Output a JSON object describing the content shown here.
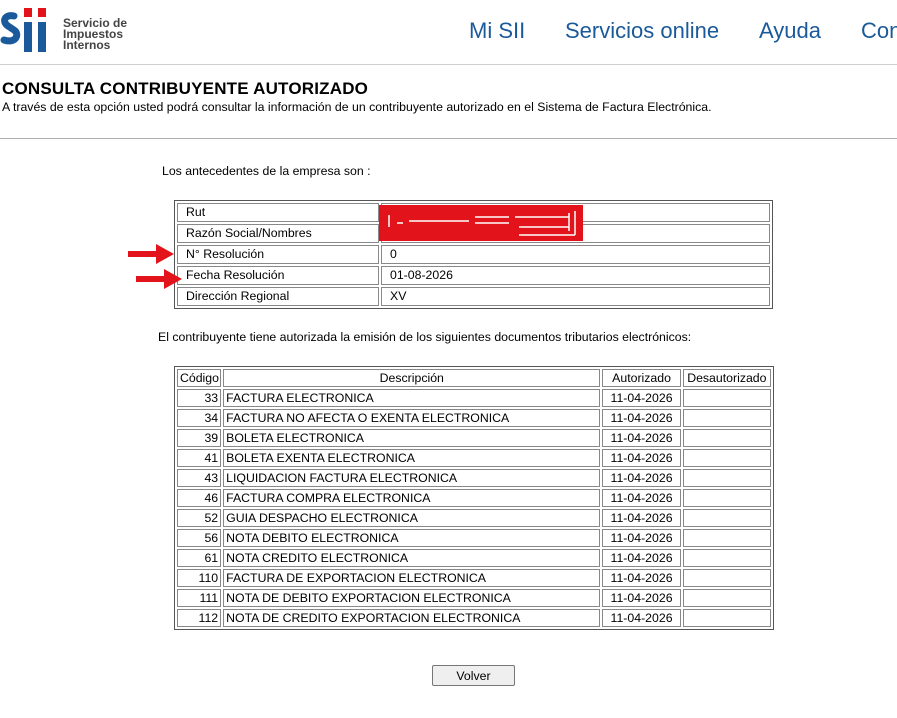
{
  "header": {
    "logo_lines": [
      "Servicio de",
      "Impuestos",
      "Internos"
    ],
    "nav": [
      "Mi SII",
      "Servicios online",
      "Ayuda",
      "Con"
    ]
  },
  "page": {
    "title": "CONSULTA CONTRIBUYENTE AUTORIZADO",
    "description": "A través de esta opción usted podrá consultar la información de un contribuyente autorizado en el Sistema de Factura Electrónica.",
    "intro": "Los antecedentes de la empresa son :"
  },
  "company": [
    {
      "label": "Rut",
      "value": ""
    },
    {
      "label": "Razón Social/Nombres",
      "value": ""
    },
    {
      "label": "N° Resolución",
      "value": "0"
    },
    {
      "label": "Fecha Resolución",
      "value": "01-08-2026"
    },
    {
      "label": "Dirección Regional",
      "value": "XV"
    }
  ],
  "documents": {
    "intro": "El contribuyente tiene autorizada la emisión de los siguientes documentos tributarios electrónicos:",
    "headers": [
      "Código",
      "Descripción",
      "Autorizado",
      "Desautorizado"
    ],
    "rows": [
      {
        "code": "33",
        "desc": "FACTURA ELECTRONICA",
        "auth": "11-04-2026",
        "unauth": ""
      },
      {
        "code": "34",
        "desc": "FACTURA NO AFECTA O EXENTA ELECTRONICA",
        "auth": "11-04-2026",
        "unauth": ""
      },
      {
        "code": "39",
        "desc": "BOLETA ELECTRONICA",
        "auth": "11-04-2026",
        "unauth": ""
      },
      {
        "code": "41",
        "desc": "BOLETA EXENTA ELECTRONICA",
        "auth": "11-04-2026",
        "unauth": ""
      },
      {
        "code": "43",
        "desc": "LIQUIDACION FACTURA ELECTRONICA",
        "auth": "11-04-2026",
        "unauth": ""
      },
      {
        "code": "46",
        "desc": "FACTURA COMPRA ELECTRONICA",
        "auth": "11-04-2026",
        "unauth": ""
      },
      {
        "code": "52",
        "desc": "GUIA DESPACHO ELECTRONICA",
        "auth": "11-04-2026",
        "unauth": ""
      },
      {
        "code": "56",
        "desc": "NOTA DEBITO ELECTRONICA",
        "auth": "11-04-2026",
        "unauth": ""
      },
      {
        "code": "61",
        "desc": "NOTA CREDITO ELECTRONICA",
        "auth": "11-04-2026",
        "unauth": ""
      },
      {
        "code": "110",
        "desc": "FACTURA DE EXPORTACION ELECTRONICA",
        "auth": "11-04-2026",
        "unauth": ""
      },
      {
        "code": "111",
        "desc": "NOTA DE DEBITO EXPORTACION ELECTRONICA",
        "auth": "11-04-2026",
        "unauth": ""
      },
      {
        "code": "112",
        "desc": "NOTA DE CREDITO EXPORTACION ELECTRONICA",
        "auth": "11-04-2026",
        "unauth": ""
      }
    ]
  },
  "button": {
    "volver": "Volver"
  },
  "colors": {
    "brand": "#1a5a9a",
    "redaction": "#e3131b",
    "arrow": "#e3131b"
  },
  "icons": {
    "logo": "sii-logo",
    "annotation": "red-arrow-icon"
  }
}
